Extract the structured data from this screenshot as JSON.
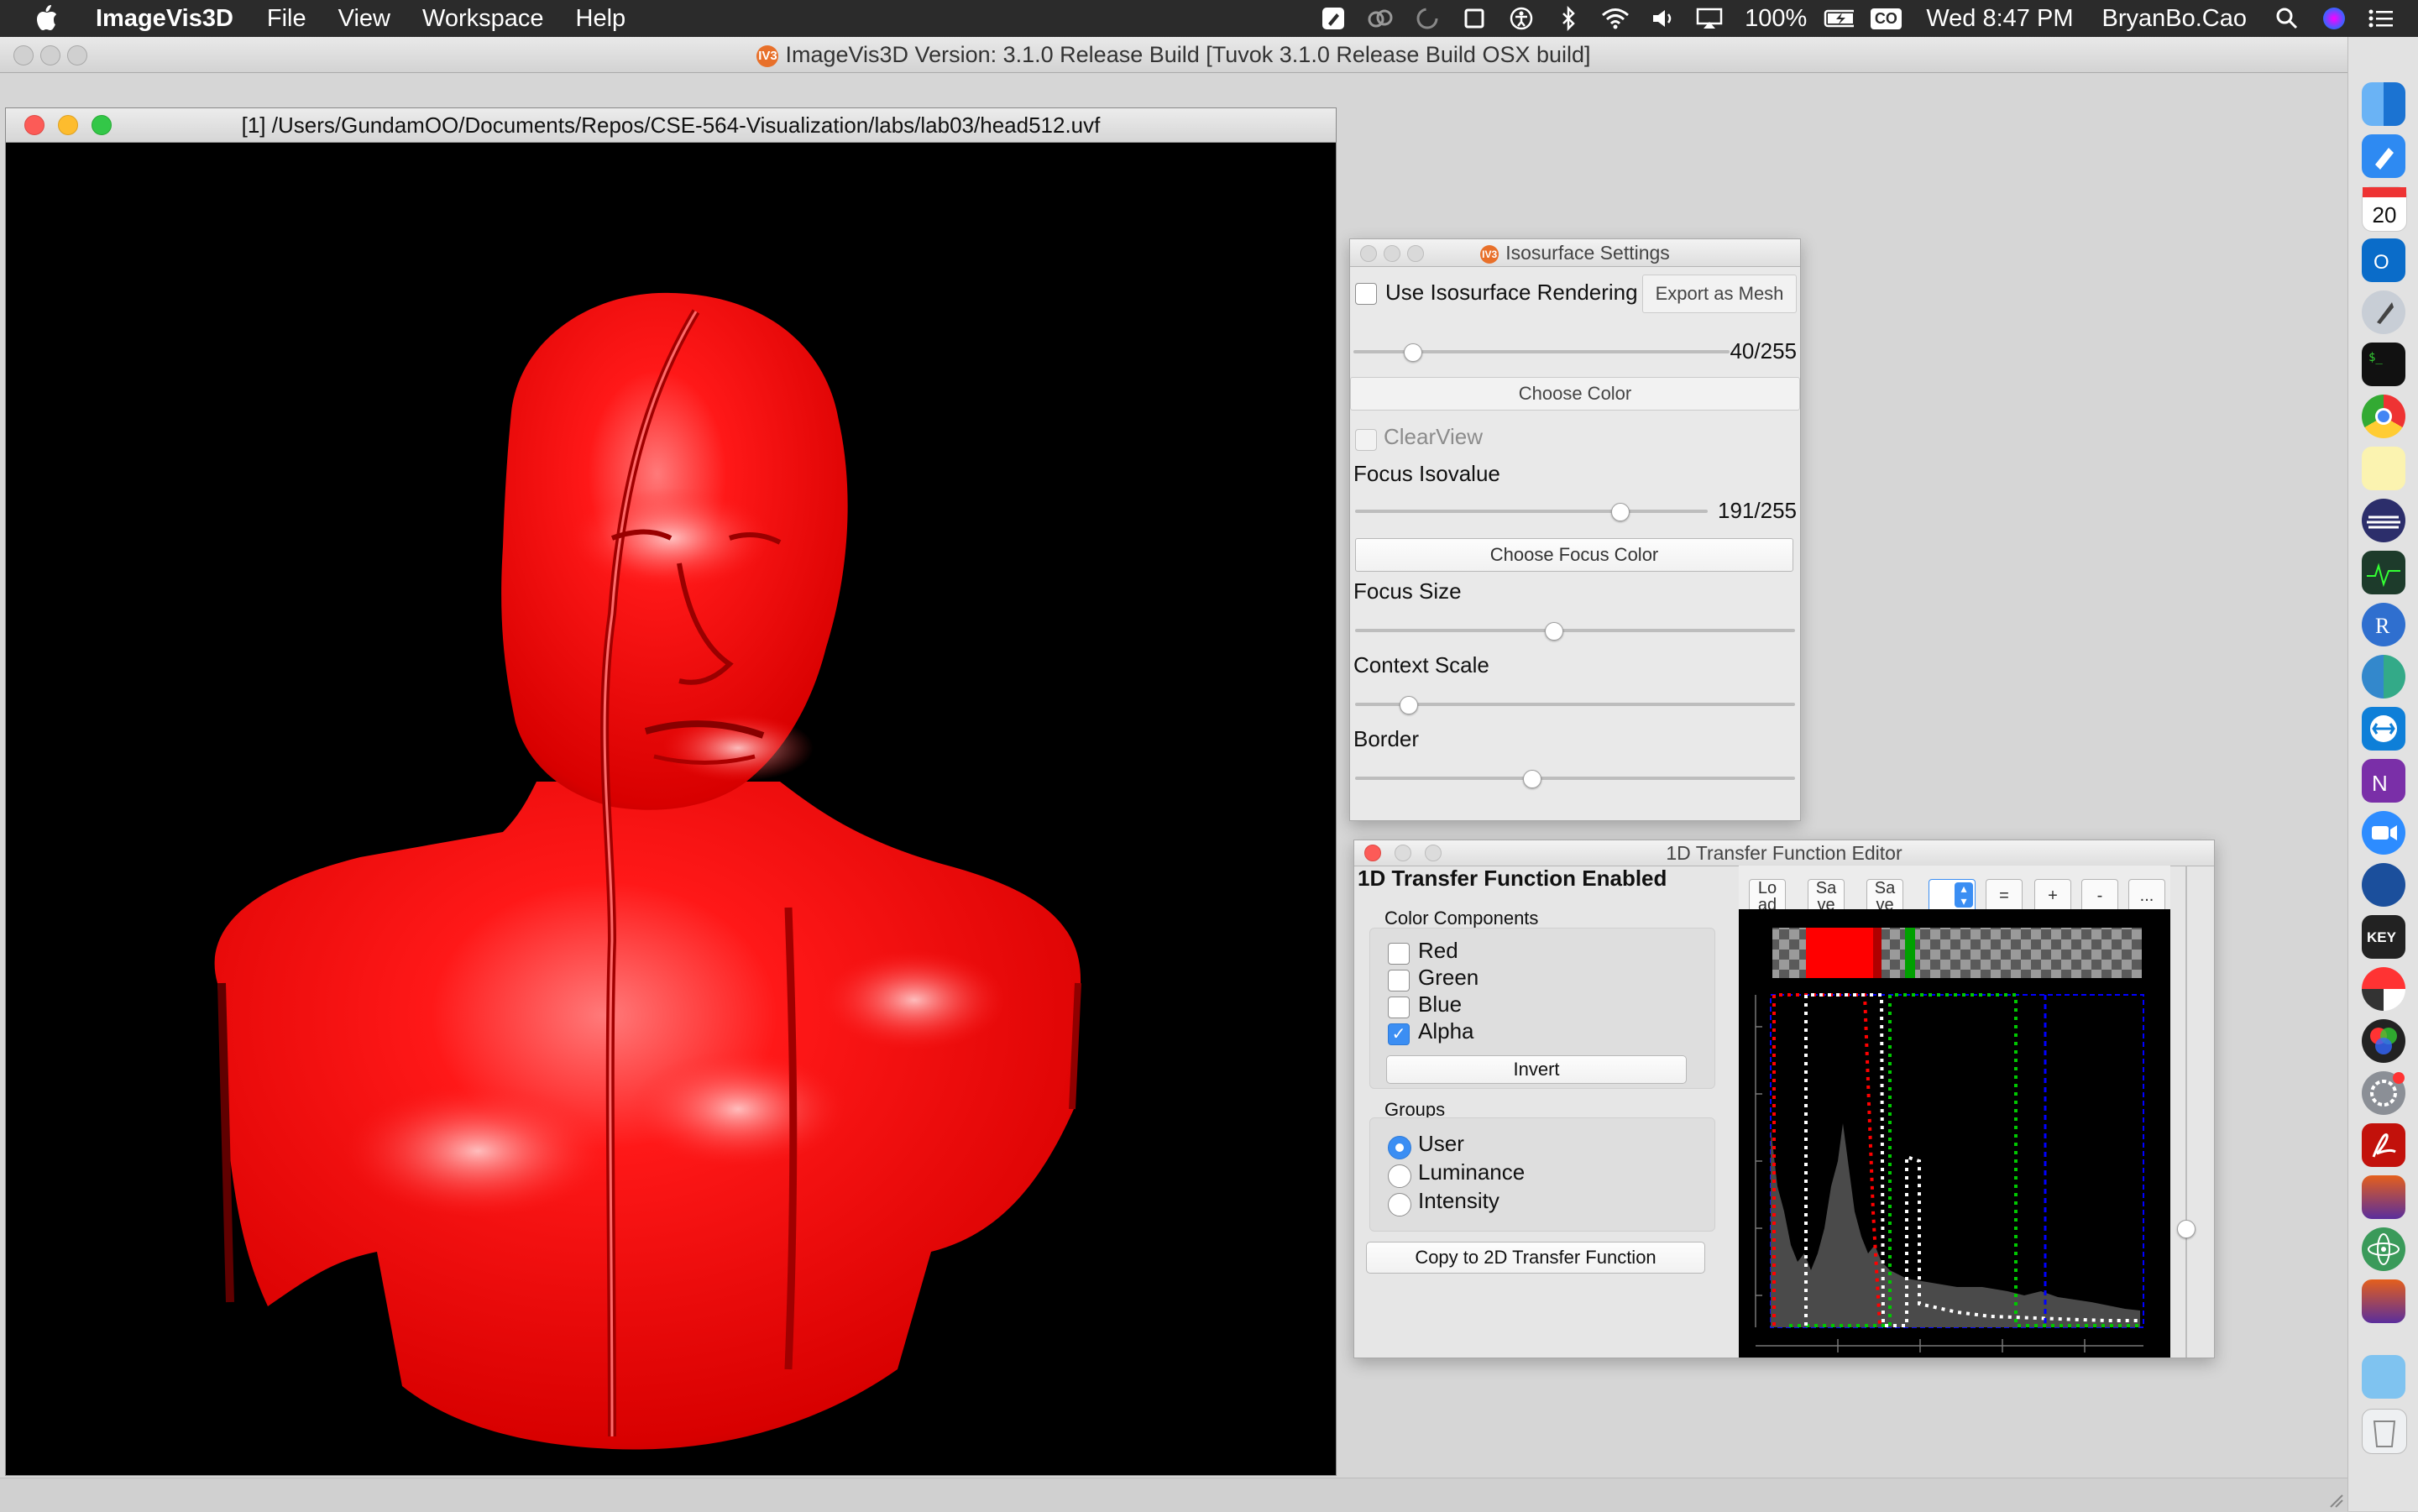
{
  "menubar": {
    "app_name": "ImageVis3D",
    "menus": [
      "File",
      "View",
      "Workspace",
      "Help"
    ],
    "battery": "100%",
    "input_source": "CO",
    "clock": "Wed 8:47 PM",
    "user": "BryanBo.Cao"
  },
  "window": {
    "title": "ImageVis3D Version: 3.1.0 Release Build [Tuvok 3.1.0 Release Build OSX build]",
    "app_badge": "IV3"
  },
  "render": {
    "title": "[1] /Users/GundamOO/Documents/Repos/CSE-564-Visualization/labs/lab03/head512.uvf",
    "surface_color": "#ff1010"
  },
  "iso": {
    "title": "Isosurface Settings",
    "use_label": "Use Isosurface Rendering",
    "use_checked": false,
    "export_label": "Export as Mesh",
    "iso_value": "40/255",
    "iso_fraction": 0.157,
    "choose_color": "Choose Color",
    "clearview_label": "ClearView",
    "focus_iso_label": "Focus Isovalue",
    "focus_iso_value": "191/255",
    "focus_iso_fraction": 0.749,
    "choose_focus_color": "Choose Focus Color",
    "focus_size_label": "Focus Size",
    "focus_size_fraction": 0.45,
    "context_scale_label": "Context Scale",
    "context_scale_fraction": 0.12,
    "border_label": "Border",
    "border_fraction": 0.4
  },
  "tf": {
    "title": "1D Transfer Function Editor",
    "enabled_label": "1D Transfer Function Enabled",
    "components_title": "Color Components",
    "components": [
      {
        "label": "Red",
        "checked": false
      },
      {
        "label": "Green",
        "checked": false
      },
      {
        "label": "Blue",
        "checked": false
      },
      {
        "label": "Alpha",
        "checked": true
      }
    ],
    "invert_label": "Invert",
    "groups_title": "Groups",
    "groups": [
      {
        "label": "User",
        "selected": true
      },
      {
        "label": "Luminance",
        "selected": false
      },
      {
        "label": "Intensity",
        "selected": false
      }
    ],
    "copy_label": "Copy to 2D Transfer Function",
    "toolbar": {
      "load": "Lo ad",
      "save": "Sa ve",
      "save_as": "Sa ve",
      "equals": "=",
      "plus": "+",
      "minus": "-",
      "more": "..."
    },
    "colors": {
      "red": "#ff0000",
      "green": "#00c800",
      "blue": "#0000ff",
      "white": "#ffffff",
      "histogram": "#4a4a4a"
    }
  }
}
